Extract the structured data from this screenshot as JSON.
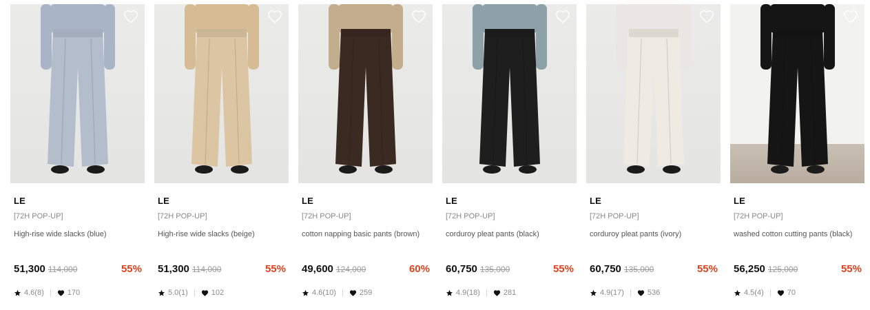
{
  "products": [
    {
      "brand": "LE",
      "tag": "[72H POP-UP]",
      "name": "High-rise wide slacks (blue)",
      "price": "51,300",
      "original_price": "114,000",
      "discount": "55%",
      "rating": "4.6(8)",
      "likes": "170",
      "pants_color": "#b3bdcc",
      "top_color": "#a9b4c6",
      "bg": "light"
    },
    {
      "brand": "LE",
      "tag": "[72H POP-UP]",
      "name": "High-rise wide slacks (beige)",
      "price": "51,300",
      "original_price": "114,000",
      "discount": "55%",
      "rating": "5.0(1)",
      "likes": "102",
      "pants_color": "#dcc5a2",
      "top_color": "#d6bc95",
      "bg": "light"
    },
    {
      "brand": "LE",
      "tag": "[72H POP-UP]",
      "name": "cotton napping basic pants (brown)",
      "price": "49,600",
      "original_price": "124,000",
      "discount": "60%",
      "rating": "4.6(10)",
      "likes": "259",
      "pants_color": "#3b2a22",
      "top_color": "#c2ae8c",
      "bg": "light"
    },
    {
      "brand": "LE",
      "tag": "[72H POP-UP]",
      "name": "corduroy pleat pants (black)",
      "price": "60,750",
      "original_price": "135,000",
      "discount": "55%",
      "rating": "4.9(18)",
      "likes": "281",
      "pants_color": "#1e1e1e",
      "top_color": "#8ea0a8",
      "bg": "light"
    },
    {
      "brand": "LE",
      "tag": "[72H POP-UP]",
      "name": "corduroy pleat pants (ivory)",
      "price": "60,750",
      "original_price": "135,000",
      "discount": "55%",
      "rating": "4.9(17)",
      "likes": "536",
      "pants_color": "#efebe2",
      "top_color": "#ebe6e4",
      "bg": "light"
    },
    {
      "brand": "LE",
      "tag": "[72H POP-UP]",
      "name": "washed cotton cutting pants (black)",
      "price": "56,250",
      "original_price": "125,000",
      "discount": "55%",
      "rating": "4.5(4)",
      "likes": "70",
      "pants_color": "#151515",
      "top_color": "#151515",
      "bg": "floor"
    }
  ],
  "icons": {
    "wishlist": "heart-outline-icon",
    "rating": "star-icon",
    "likes": "heart-filled-icon"
  },
  "colors": {
    "discount": "#e0421d",
    "text": "#111111",
    "muted": "#888888"
  }
}
